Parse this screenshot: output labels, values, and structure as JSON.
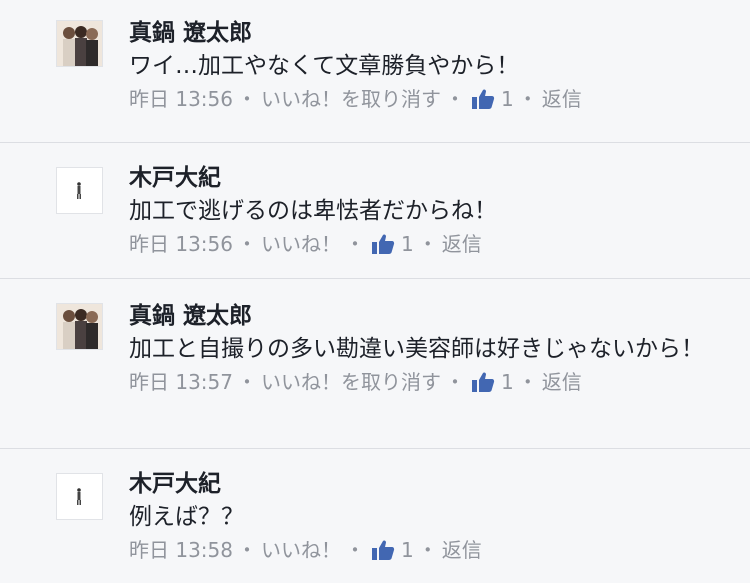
{
  "comments": [
    {
      "author": "真鍋 遼太郎",
      "avatar": "photo-group-avatar",
      "text": "ワイ…加工やなくて文章勝負やから！",
      "time": "昨日 13:56",
      "like_label": "いいね！を取り消す",
      "like_count": "1",
      "reply_label": "返信"
    },
    {
      "author": "木戸大紀",
      "avatar": "small-figure-avatar",
      "text": "加工で逃げるのは卑怯者だからね！",
      "time": "昨日 13:56",
      "like_label": "いいね！",
      "like_count": "1",
      "reply_label": "返信"
    },
    {
      "author": "真鍋 遼太郎",
      "avatar": "photo-group-avatar",
      "text": "加工と自撮りの多い勘違い美容師は好きじゃないから！",
      "time": "昨日 13:57",
      "like_label": "いいね！を取り消す",
      "like_count": "1",
      "reply_label": "返信"
    },
    {
      "author": "木戸大紀",
      "avatar": "small-figure-avatar",
      "text": "例えば？？",
      "time": "昨日 13:58",
      "like_label": "いいね！",
      "like_count": "1",
      "reply_label": "返信"
    }
  ],
  "separator": "・",
  "colors": {
    "like_blue": "#4267b2",
    "meta_gray": "#90949c",
    "text": "#1d2129"
  }
}
